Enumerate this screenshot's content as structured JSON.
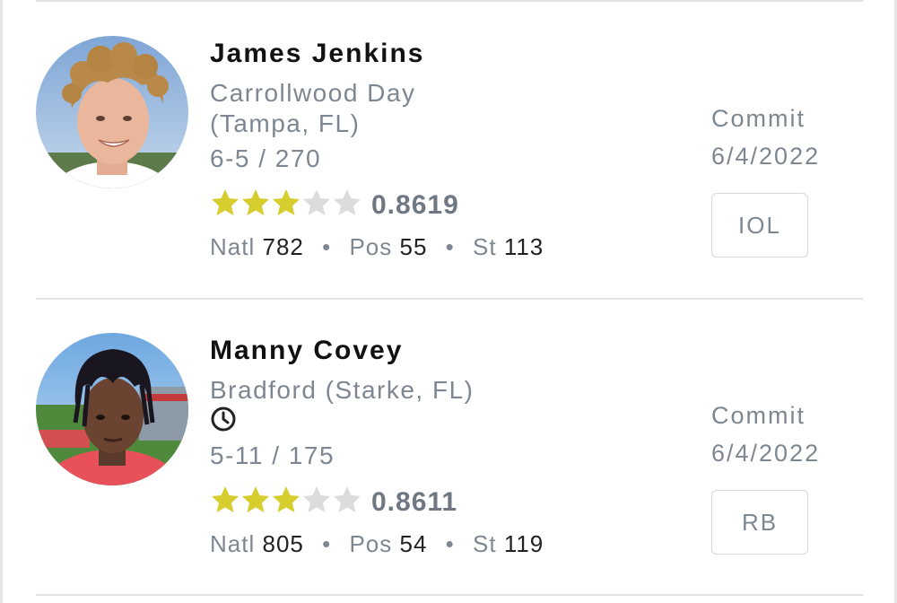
{
  "players": [
    {
      "name": "James Jenkins",
      "school": "Carrollwood Day (Tampa, FL)",
      "has_clock": false,
      "height_weight": "6-5 / 270",
      "stars": 3,
      "max_stars": 5,
      "rating": "0.8619",
      "ranks": {
        "natl_label": "Natl",
        "natl": "782",
        "pos_label": "Pos",
        "pos": "55",
        "st_label": "St",
        "st": "113"
      },
      "status": "Commit",
      "date": "6/4/2022",
      "position": "IOL"
    },
    {
      "name": "Manny Covey",
      "school": "Bradford (Starke, FL)",
      "has_clock": true,
      "clock_icon": "clock-icon",
      "height_weight": "5-11 / 175",
      "stars": 3,
      "max_stars": 5,
      "rating": "0.8611",
      "ranks": {
        "natl_label": "Natl",
        "natl": "805",
        "pos_label": "Pos",
        "pos": "54",
        "st_label": "St",
        "st": "119"
      },
      "status": "Commit",
      "date": "6/4/2022",
      "position": "RB"
    }
  ],
  "colors": {
    "star_filled": "#d6cd2e",
    "star_empty": "#dcdcdc",
    "muted_text": "#7e8791",
    "rating_text": "#6f7882"
  }
}
